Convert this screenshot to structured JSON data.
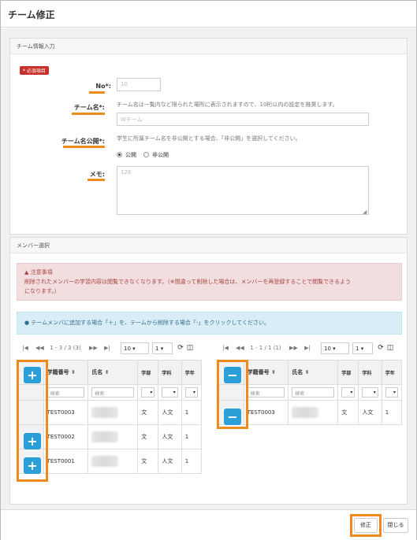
{
  "modal": {
    "title": "チーム修正"
  },
  "team_info": {
    "section_title": "チーム情報入力",
    "required_badge": "* 必須項目",
    "no_label": "No*:",
    "no_value": "10",
    "name_label": "チーム名*:",
    "name_help": "チーム名は一覧内など限られた場所に表示されますので、10桁以内の設定を推奨します。",
    "name_value": "Wチーム",
    "public_label": "チーム名公開*:",
    "public_help": "学生に所属チーム名を非公開とする場合、「非公開」を選択してください。",
    "public_option": "公開",
    "private_option": "非公開",
    "memo_label": "メモ:",
    "memo_value": "126"
  },
  "member_select": {
    "section_title": "メンバー選択",
    "warning_title": "注意事項",
    "warning_line1": "削除されたメンバーの学習内容は閲覧できなくなります。（※間違って削除した場合は、メンバーを再登録することで閲覧できるよう",
    "warning_line2": "になります。）",
    "info_text": "テームメンバに追加する場合「＋」を、テームから削除する場合「-」をクリックしてください。"
  },
  "left_table": {
    "pager_info": "1 - 3 / 3 (3)",
    "page_size": "10",
    "page": "1",
    "headers": {
      "student_no": "学籍番号",
      "name": "氏名",
      "dept": "学部",
      "subject": "学科",
      "year": "学年"
    },
    "filter_placeholder": "検索",
    "rows": [
      {
        "student_no": "TEST0003",
        "dept": "文",
        "subject": "人文",
        "year": "1"
      },
      {
        "student_no": "TEST0002",
        "dept": "文",
        "subject": "人文",
        "year": "1"
      },
      {
        "student_no": "TEST0001",
        "dept": "文",
        "subject": "人文",
        "year": "1"
      }
    ]
  },
  "right_table": {
    "pager_info": "1 - 1 / 1 (1)",
    "page_size": "10",
    "page": "1",
    "headers": {
      "student_no": "学籍番号",
      "name": "氏名",
      "dept": "学部",
      "subject": "学科",
      "year": "学年"
    },
    "filter_placeholder": "検索",
    "rows": [
      {
        "student_no": "TEST0003",
        "dept": "文",
        "subject": "人文",
        "year": "1"
      }
    ]
  },
  "footer": {
    "submit_label": "修正",
    "close_label": "閉じる"
  },
  "colors": {
    "highlight": "#f08a1c",
    "primary_button": "#2a9fd8",
    "danger_badge": "#c9302c"
  }
}
